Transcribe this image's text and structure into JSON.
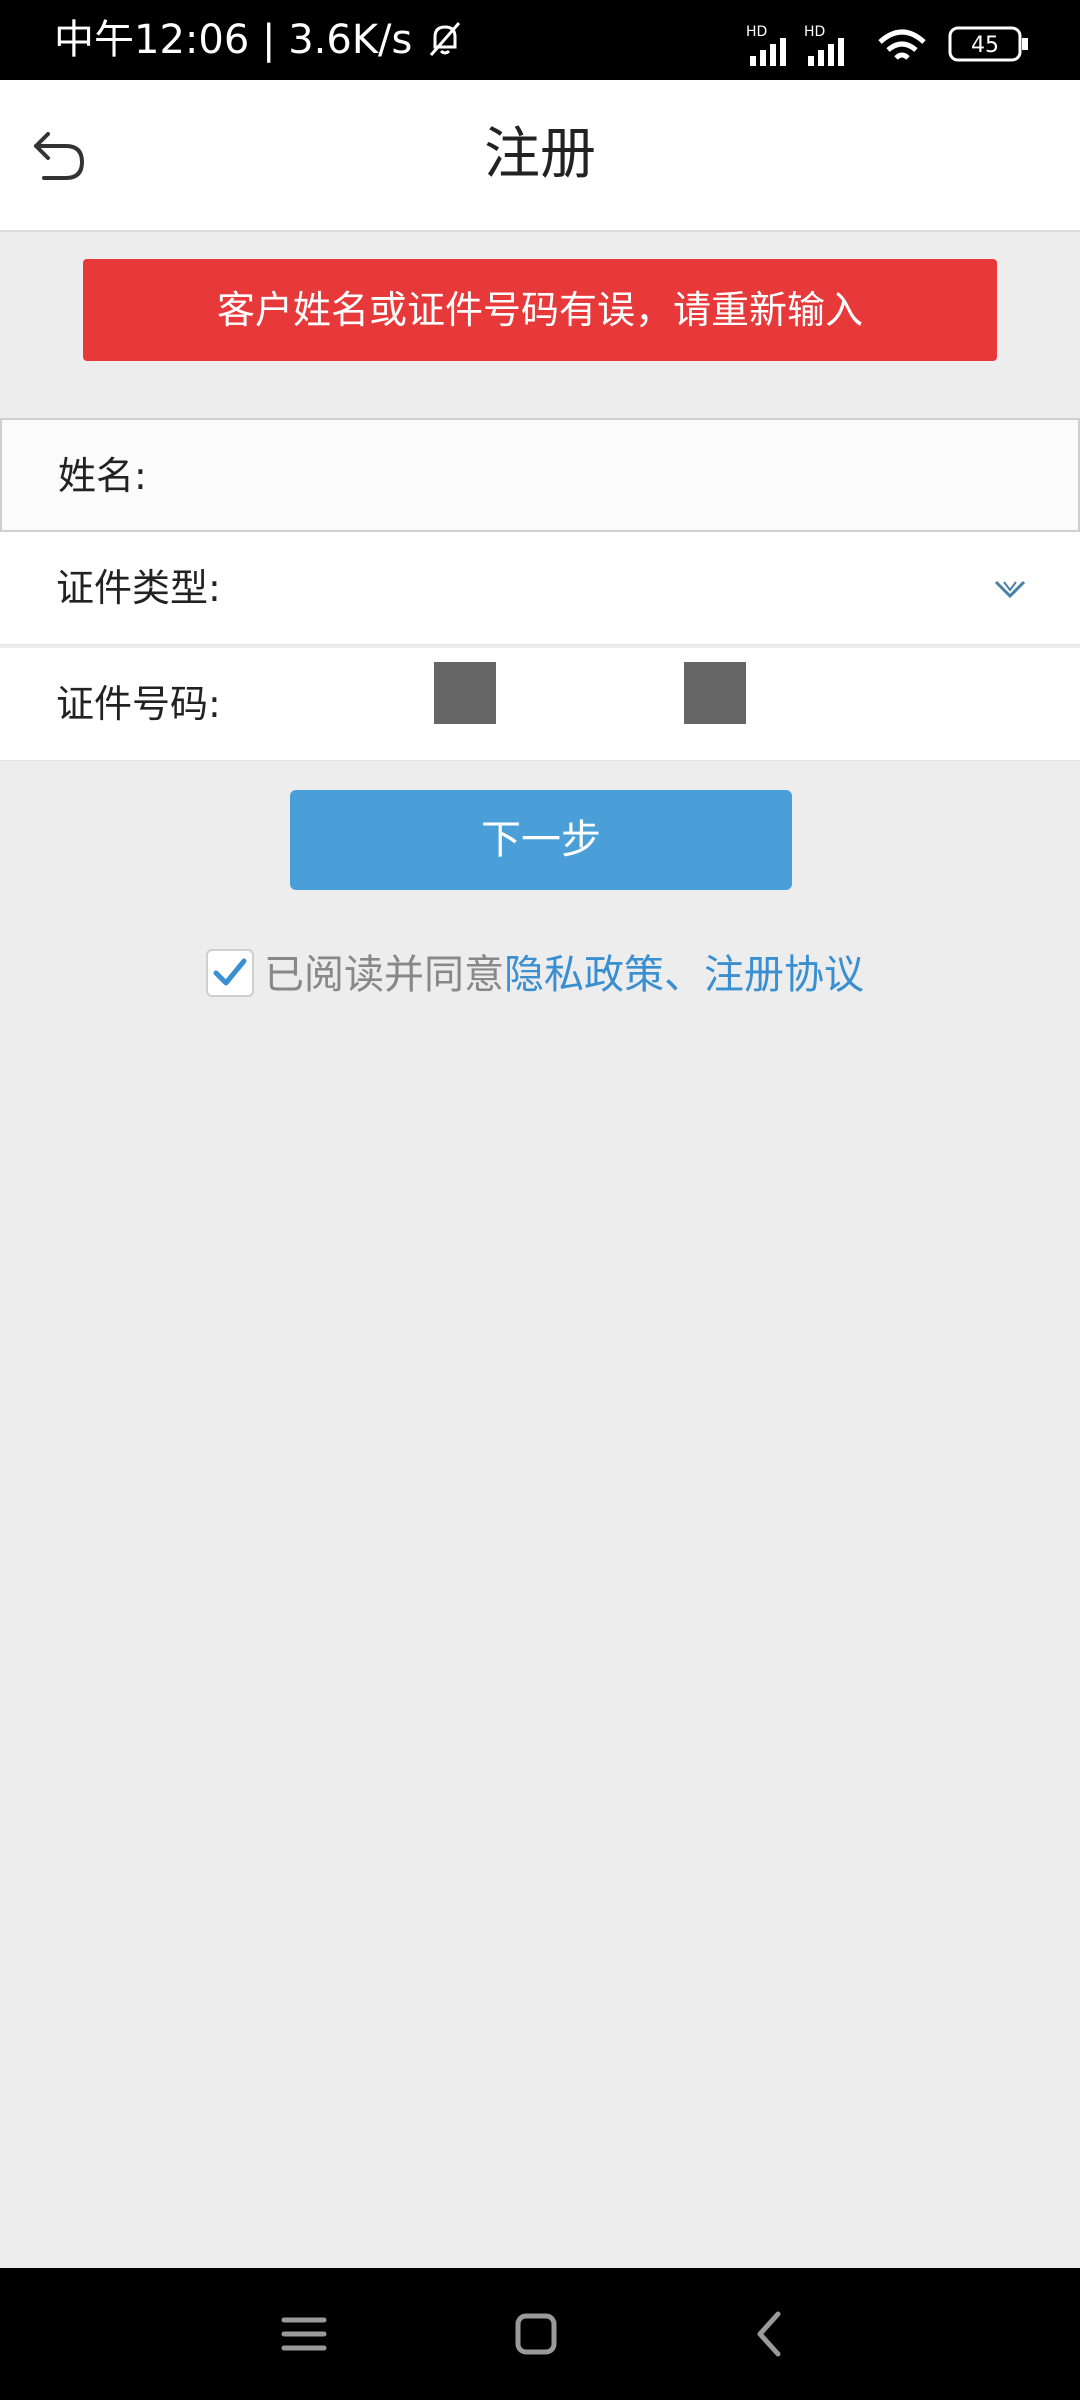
{
  "status_bar": {
    "time_label": "中午12:06",
    "separator": "|",
    "net_speed": "3.6K/s",
    "battery_level": "45",
    "signal_badge_1": "HD",
    "signal_badge_2": "HD"
  },
  "header": {
    "title": "注册"
  },
  "error": {
    "message": "客户姓名或证件号码有误，请重新输入"
  },
  "form": {
    "name_label": "姓名:",
    "id_type_label": "证件类型:",
    "id_number_label": "证件号码:"
  },
  "next_button_label": "下一步",
  "agreement": {
    "checked": true,
    "text": "已阅读并同意",
    "links_text": "隐私政策、注册协议"
  },
  "colors": {
    "error": "#e8393a",
    "primary": "#4a9fd8",
    "link": "#3a8fd0",
    "background": "#ededed"
  }
}
